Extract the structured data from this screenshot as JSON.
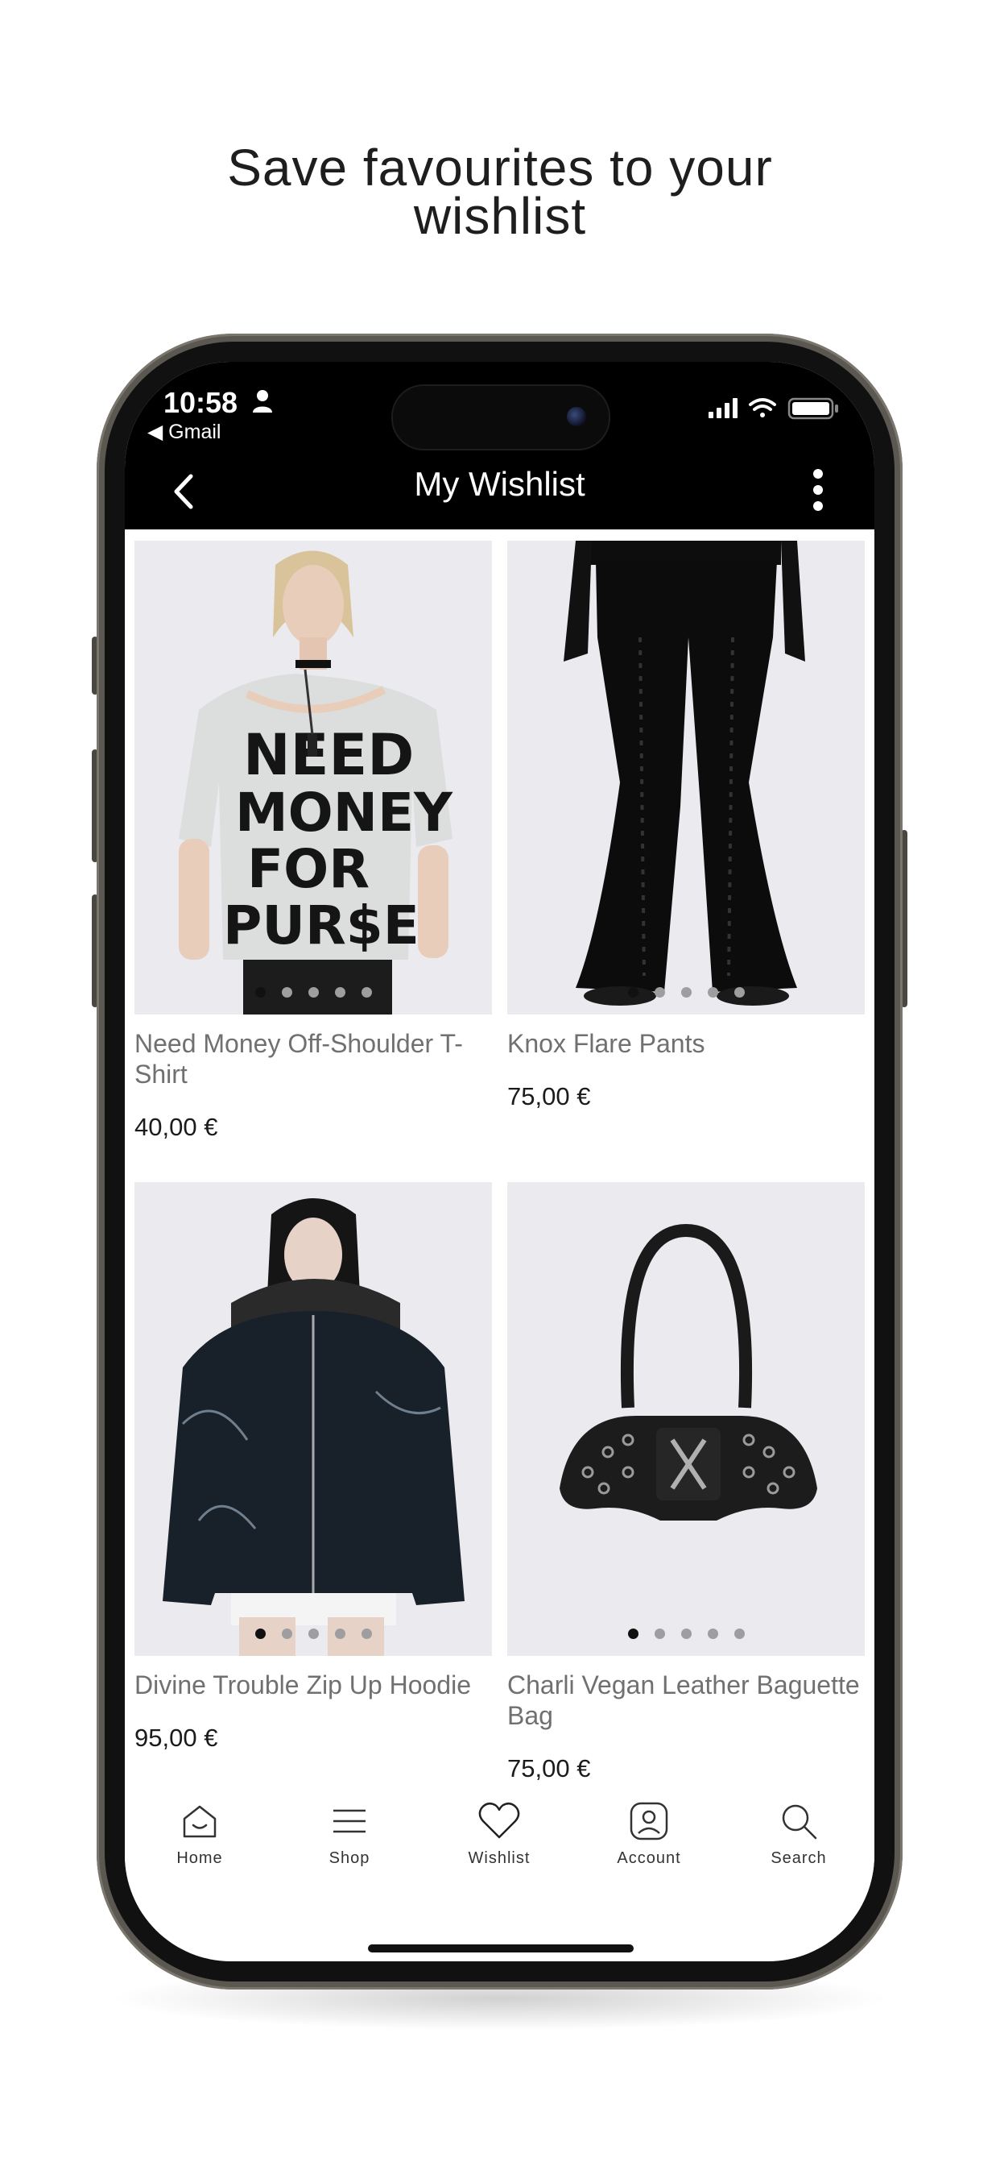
{
  "headline": {
    "line1": "Save favourites to your",
    "line2": "wishlist"
  },
  "status_bar": {
    "time": "10:58",
    "back_app": "◀ Gmail",
    "icons": [
      "person-icon",
      "signal-icon",
      "wifi-icon",
      "battery-icon"
    ]
  },
  "nav": {
    "title": "My Wishlist",
    "back_icon": "chevron-left-icon",
    "more_icon": "more-vertical-icon"
  },
  "products": [
    {
      "name": "Need Money Off-Shoulder T-Shirt",
      "price": "40,00 €",
      "image_dots": 5
    },
    {
      "name": "Knox Flare Pants",
      "price": "75,00 €",
      "image_dots": 5
    },
    {
      "name": "Divine Trouble Zip Up Hoodie",
      "price": "95,00 €",
      "image_dots": 5
    },
    {
      "name": "Charli Vegan Leather Baguette Bag",
      "price": "75,00 €",
      "image_dots": 5
    }
  ],
  "tabbar": {
    "items": [
      {
        "label": "Home",
        "icon": "home-icon"
      },
      {
        "label": "Shop",
        "icon": "menu-icon"
      },
      {
        "label": "Wishlist",
        "icon": "heart-icon"
      },
      {
        "label": "Account",
        "icon": "account-icon"
      },
      {
        "label": "Search",
        "icon": "search-icon"
      }
    ]
  },
  "colors": {
    "header_bg": "#000000",
    "image_bg": "#ebeaee",
    "product_name": "#707070",
    "price": "#1b1b1b"
  }
}
